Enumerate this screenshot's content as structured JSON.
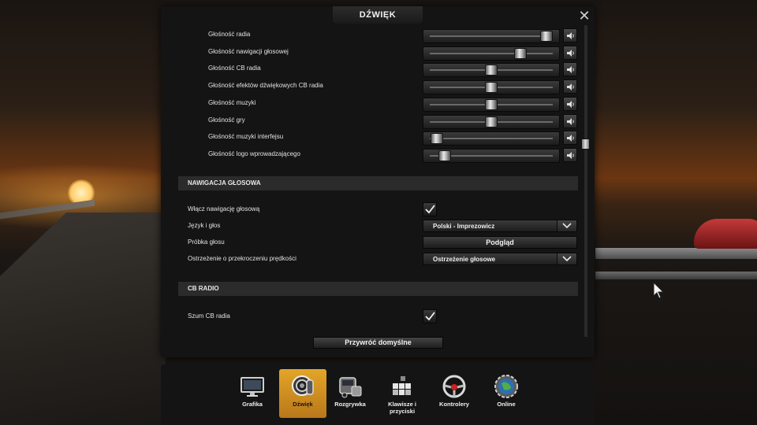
{
  "dialog": {
    "title": "DŹWIĘK",
    "reset_label": "Przywróć domyślne"
  },
  "volumes": [
    {
      "label": "Głośność radia",
      "level": 0.95
    },
    {
      "label": "Głośność nawigacji głosowej",
      "level": 0.74
    },
    {
      "label": "Głośność CB radia",
      "level": 0.5
    },
    {
      "label": "Głośność efektów dźwiękowych CB radia",
      "level": 0.5
    },
    {
      "label": "Głośność muzyki",
      "level": 0.5
    },
    {
      "label": "Głośność gry",
      "level": 0.5
    },
    {
      "label": "Głośność muzyki interfejsu",
      "level": 0.06
    },
    {
      "label": "Głośność logo wprowadzającego",
      "level": 0.12
    }
  ],
  "voice_nav": {
    "header": "NAWIGACJA GŁOSOWA",
    "enable_label": "Włącz nawigację głosową",
    "enable_checked": true,
    "language_label": "Język i głos",
    "language_value": "Polski - Imprezowicz",
    "sample_label": "Próbka głosu",
    "sample_button": "Podgląd",
    "speeding_label": "Ostrzeżenie o przekroczeniu prędkości",
    "speeding_value": "Ostrzeżenie głosowe"
  },
  "cb_radio": {
    "header": "CB RADIO",
    "noise_label": "Szum CB radia",
    "noise_checked": true
  },
  "categories": [
    {
      "label": "Grafika",
      "icon": "monitor-icon",
      "active": false
    },
    {
      "label": "Dźwięk",
      "icon": "speaker-icon",
      "active": true
    },
    {
      "label": "Rozgrywka",
      "icon": "truck-icon",
      "active": false
    },
    {
      "label": "Klawisze i przyciski",
      "icon": "keyboard-icon",
      "active": false
    },
    {
      "label": "Kontrolery",
      "icon": "steering-wheel-icon",
      "active": false
    },
    {
      "label": "Online",
      "icon": "globe-gear-icon",
      "active": false
    }
  ],
  "colors": {
    "accent": "#e3a528",
    "panel": "#141414",
    "section": "#2b2b2b"
  }
}
